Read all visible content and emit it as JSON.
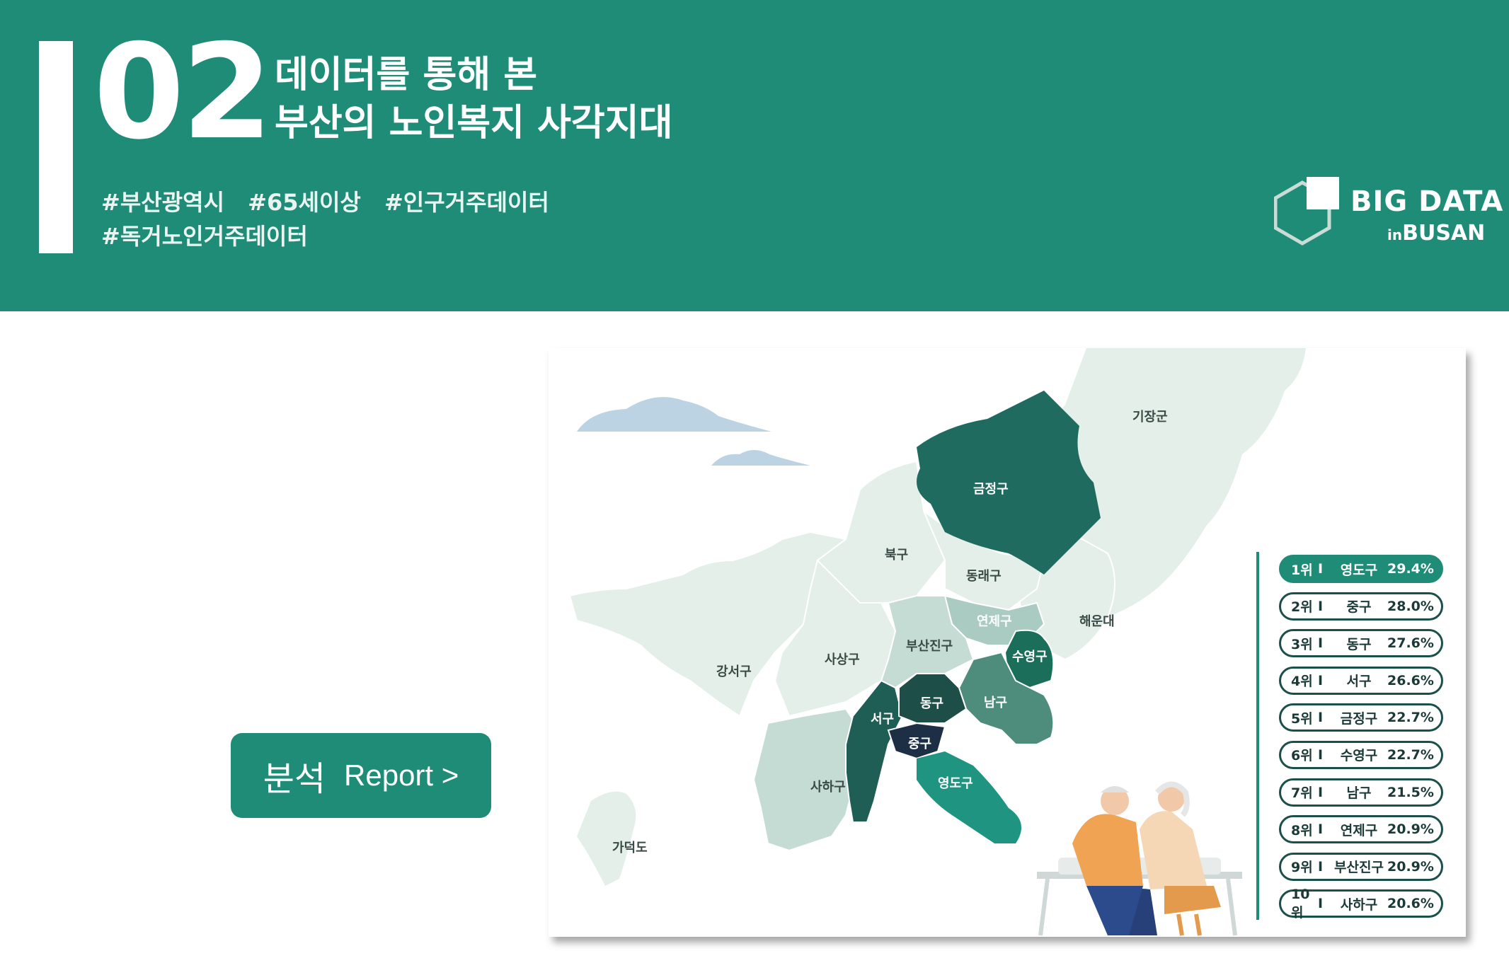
{
  "header": {
    "number": "02",
    "title_line1": "데이터를 통해 본",
    "title_line2": "부산의 노인복지 사각지대",
    "tags_line1": [
      "#부산광역시",
      "#65세이상",
      "#인구거주데이터"
    ],
    "tags_line2": [
      "#독거노인거주데이터"
    ],
    "logo_line1": "BIG DATA",
    "logo_in": "in",
    "logo_line2": "BUSAN"
  },
  "button": {
    "korean": "분석",
    "english": "Report >"
  },
  "map": {
    "districts": [
      "기장군",
      "금정구",
      "북구",
      "동래구",
      "연제구",
      "해운대",
      "수영구",
      "부산진구",
      "사상구",
      "강서구",
      "동구",
      "남구",
      "서구",
      "중구",
      "영도구",
      "사하구",
      "가덕도"
    ]
  },
  "ranking": [
    {
      "rank": "1위",
      "sep": "I",
      "district": "영도구",
      "value": "29.4%"
    },
    {
      "rank": "2위",
      "sep": "I",
      "district": "중구",
      "value": "28.0%"
    },
    {
      "rank": "3위",
      "sep": "I",
      "district": "동구",
      "value": "27.6%"
    },
    {
      "rank": "4위",
      "sep": "I",
      "district": "서구",
      "value": "26.6%"
    },
    {
      "rank": "5위",
      "sep": "I",
      "district": "금정구",
      "value": "22.7%"
    },
    {
      "rank": "6위",
      "sep": "I",
      "district": "수영구",
      "value": "22.7%"
    },
    {
      "rank": "7위",
      "sep": "I",
      "district": "남구",
      "value": "21.5%"
    },
    {
      "rank": "8위",
      "sep": "I",
      "district": "연제구",
      "value": "20.9%"
    },
    {
      "rank": "9위",
      "sep": "I",
      "district": "부산진구",
      "value": "20.9%"
    },
    {
      "rank": "10위",
      "sep": "I",
      "district": "사하구",
      "value": "20.6%"
    }
  ],
  "colors": {
    "header": "#1f8c77",
    "dark": "#1b4f49",
    "navy": "#1c2f45",
    "light": "#e4efe9"
  }
}
